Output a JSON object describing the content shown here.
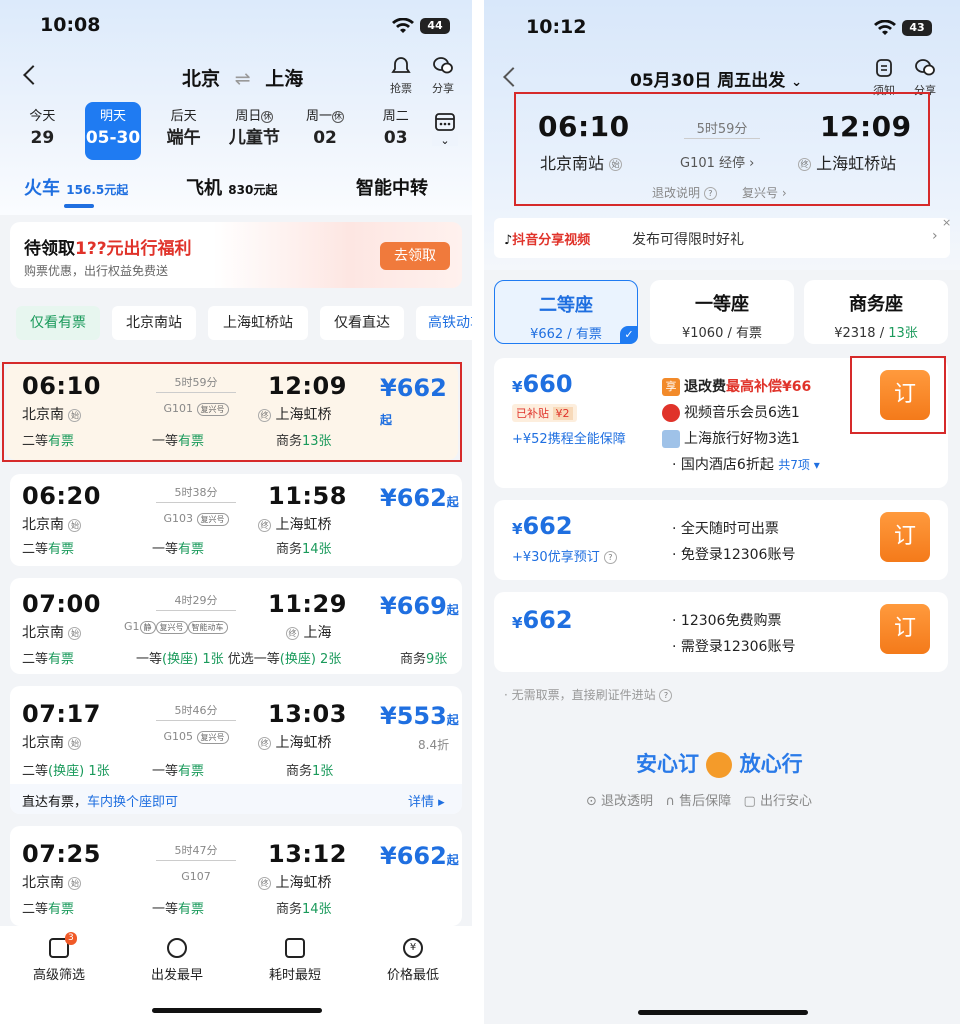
{
  "left": {
    "status": {
      "time": "10:08",
      "battery": "44"
    },
    "nav": {
      "from": "北京",
      "swap": "⇌",
      "to": "上海",
      "grab_label": "抢票",
      "share_label": "分享"
    },
    "dates": [
      {
        "top": "今天",
        "bottom": "29",
        "holiday": ""
      },
      {
        "top": "明天",
        "bottom": "05-30",
        "holiday": "",
        "selected": true
      },
      {
        "top": "后天",
        "bottom": "端午",
        "holiday": ""
      },
      {
        "top": "周日",
        "bottom": "儿童节",
        "holiday": "休"
      },
      {
        "top": "周一",
        "bottom": "02",
        "holiday": "休"
      },
      {
        "top": "周二",
        "bottom": "03",
        "holiday": ""
      }
    ],
    "tabs": [
      {
        "label": "火车",
        "sub": "156.5元起",
        "active": true
      },
      {
        "label": "飞机",
        "sub": "830元起"
      },
      {
        "label": "智能中转",
        "sub": ""
      }
    ],
    "promo": {
      "title_prefix": "待领取",
      "title_red": "1??元出行福利",
      "subtitle": "购票优惠，出行权益免费送",
      "button": "去领取"
    },
    "filters": [
      "仅看有票",
      "北京南站",
      "上海虹桥站",
      "仅看直达",
      "高铁动车"
    ],
    "trains": [
      {
        "dep": "06:10",
        "dep_st": "北京南",
        "dur": "5时59分",
        "code": "G101",
        "tag": "复兴号",
        "tag2": "",
        "arr": "12:09",
        "arr_st": "上海虹桥",
        "price": "¥662",
        "price_suffix": "起",
        "discount": "",
        "seat1": "二等",
        "seat1_v": "有票",
        "seat2": "一等",
        "seat2_v": "有票",
        "seat3": "商务",
        "seat3_v": "13张"
      },
      {
        "dep": "06:20",
        "dep_st": "北京南",
        "dur": "5时38分",
        "code": "G103",
        "tag": "复兴号",
        "tag2": "",
        "arr": "11:58",
        "arr_st": "上海虹桥",
        "price": "¥662",
        "price_suffix": "起",
        "discount": "",
        "seat1": "二等",
        "seat1_v": "有票",
        "seat2": "一等",
        "seat2_v": "有票",
        "seat3": "商务",
        "seat3_v": "14张"
      },
      {
        "dep": "07:00",
        "dep_st": "北京南",
        "dur": "4时29分",
        "code": "G1",
        "tag": "复兴号",
        "tag2": "智能动车",
        "tag0": "静",
        "arr": "11:29",
        "arr_st": "上海",
        "price": "¥669",
        "price_suffix": "起",
        "discount": "",
        "seat1": "二等",
        "seat1_v": "有票",
        "seat2": "一等",
        "seat2_v": "1张",
        "seat2_x": "(换座)",
        "seat2b": "优选一等",
        "seat2b_x": "(换座)",
        "seat2b_v": "2张",
        "seat3": "商务",
        "seat3_v": "9张"
      },
      {
        "dep": "07:17",
        "dep_st": "北京南",
        "dur": "5时46分",
        "code": "G105",
        "tag": "复兴号",
        "tag2": "",
        "arr": "13:03",
        "arr_st": "上海虹桥",
        "price": "¥553",
        "price_suffix": "起",
        "discount": "8.4折",
        "seat1": "二等",
        "seat1_x": "(换座)",
        "seat1_v": "1张",
        "seat2": "一等",
        "seat2_v": "有票",
        "seat3": "商务",
        "seat3_v": "1张",
        "note": "直达有票，",
        "note_blue": "车内换个座即可",
        "note_link": "详情 ▸"
      },
      {
        "dep": "07:25",
        "dep_st": "北京南",
        "dur": "5时47分",
        "code": "G107",
        "tag": "",
        "tag2": "",
        "arr": "13:12",
        "arr_st": "上海虹桥",
        "price": "¥662",
        "price_suffix": "起",
        "discount": "",
        "seat1": "二等",
        "seat1_v": "有票",
        "seat2": "一等",
        "seat2_v": "有票",
        "seat3": "商务",
        "seat3_v": "14张"
      }
    ],
    "bottom": [
      {
        "label": "高级筛选",
        "badge": "3",
        "icon": "filter-icon"
      },
      {
        "label": "出发最早",
        "icon": "clock-icon"
      },
      {
        "label": "耗时最短",
        "icon": "hourglass-icon"
      },
      {
        "label": "价格最低",
        "icon": "yuan-icon"
      }
    ]
  },
  "right": {
    "status": {
      "time": "10:12",
      "battery": "43"
    },
    "nav": {
      "title": "05月30日 周五出发",
      "notice_label": "须知",
      "share_label": "分享"
    },
    "trip": {
      "dep": "06:10",
      "dep_st": "北京南站",
      "dur": "5时59分",
      "code": "G101 经停 ›",
      "arr": "12:09",
      "arr_st": "上海虹桥站",
      "refund": "退改说明",
      "train_type": "复兴号 ›"
    },
    "douyin": {
      "brand": "抖音分享视频",
      "text": "发布可得限时好礼"
    },
    "seats": [
      {
        "name": "二等座",
        "price": "¥662",
        "avail": "有票",
        "selected": true
      },
      {
        "name": "一等座",
        "price": "¥1060",
        "avail": "有票"
      },
      {
        "name": "商务座",
        "price": "¥2318",
        "avail": "13张"
      }
    ],
    "options": [
      {
        "price": "660",
        "sub_tag": "已补贴",
        "sub_amt": "¥2",
        "extra": "+¥52携程全能保障",
        "f1_tag": "享",
        "f1": "退改费",
        "f1_red": "最高补偿¥66",
        "f2": "视频音乐会员6选1",
        "f3": "上海旅行好物3选1",
        "f4": "国内酒店6折起",
        "f4_more": "共7项 ▾",
        "book": "订"
      },
      {
        "price": "662",
        "extra": "+¥30优享预订",
        "f1": "全天随时可出票",
        "f2": "免登录12306账号",
        "book": "订"
      },
      {
        "price": "662",
        "f1": "12306免费购票",
        "f2": "需登录12306账号",
        "book": "订"
      }
    ],
    "hint": "· 无需取票，直接刷证件进站",
    "slogan_a": "安心订",
    "slogan_b": "放心行",
    "assure": [
      "退改透明",
      "售后保障",
      "出行安心"
    ]
  },
  "colors": {
    "accent": "#1f7bf2",
    "orange": "#f47a1a",
    "green": "#1a9a5b",
    "red": "#d62a2a"
  }
}
